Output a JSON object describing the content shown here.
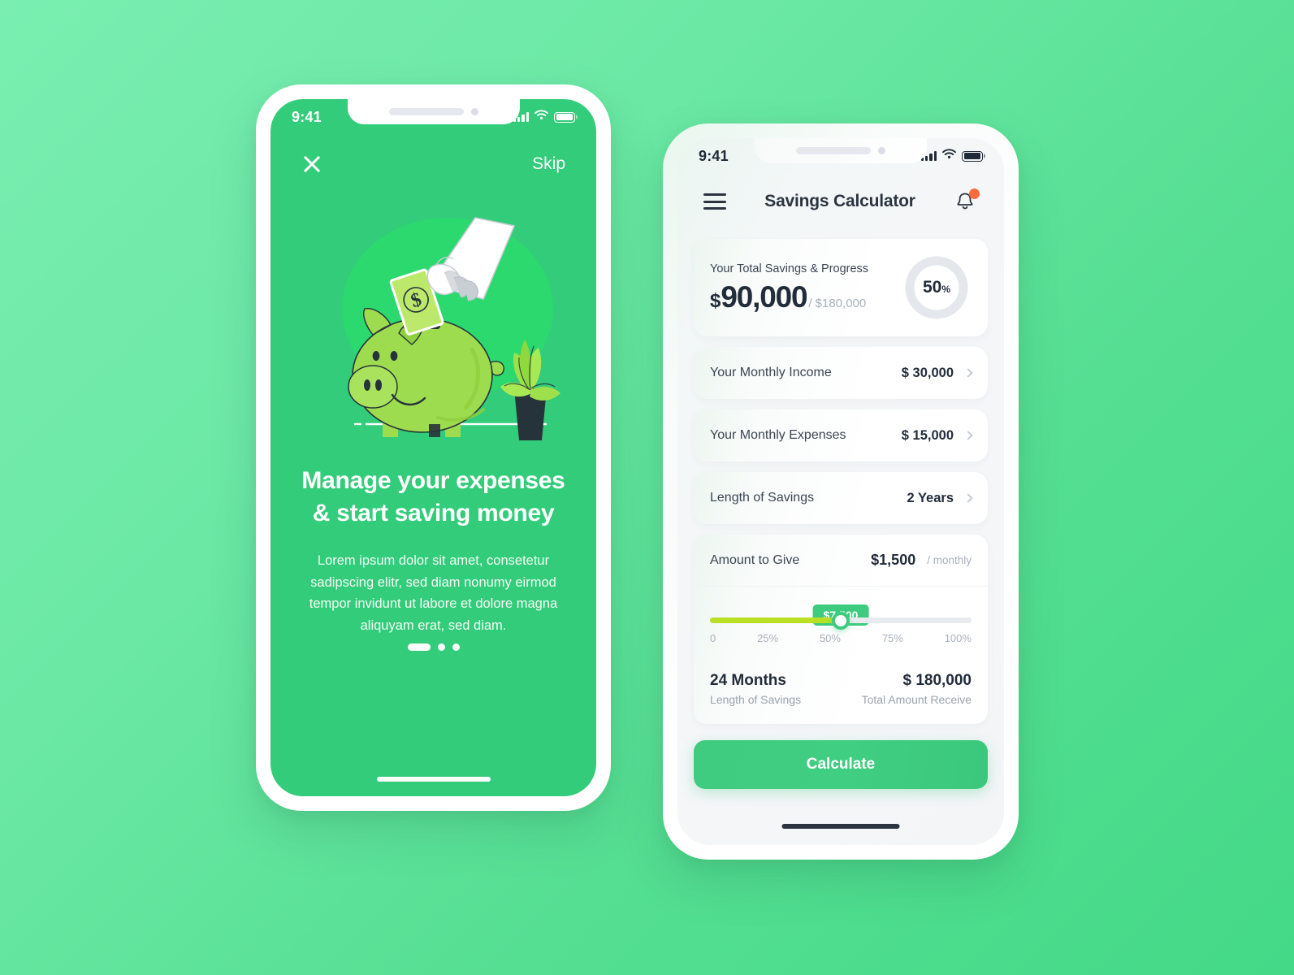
{
  "onboarding": {
    "status_bar": {
      "time": "9:41",
      "signal_icon": "signal-bars-icon",
      "wifi_icon": "wifi-icon",
      "battery_icon": "battery-icon"
    },
    "close_label": "✕",
    "skip_label": "Skip",
    "illustration_name": "hand-putting-money-in-piggy-bank-illustration",
    "title_line1": "Manage your expenses",
    "title_line2": "& start saving money",
    "description": "Lorem ipsum dolor sit amet, consetetur sadipscing elitr, sed diam nonumy eirmod tempor invidunt ut labore et dolore magna aliquyam erat, sed diam.",
    "pager": {
      "total": 3,
      "active_index": 0
    }
  },
  "calculator": {
    "status_bar": {
      "time": "9:41",
      "signal_icon": "signal-bars-icon",
      "wifi_icon": "wifi-icon",
      "battery_icon": "battery-icon"
    },
    "app_bar": {
      "menu_icon": "hamburger-menu-icon",
      "title": "Savings Calculator",
      "notifications_icon": "bell-icon",
      "badge_color": "#FF6B3D"
    },
    "savings_card": {
      "label": "Your Total Savings & Progress",
      "currency": "$",
      "amount": "90,000",
      "of_total": "/ $180,000",
      "progress_percent": "50",
      "percent_symbol": "%",
      "progress_value": 50,
      "ring_fill_color": "#3CCB7F",
      "ring_track_color": "#E4E7EC"
    },
    "rows": [
      {
        "label": "Your Monthly Income",
        "value": "$ 30,000",
        "chevron_icon": "chevron-right-icon"
      },
      {
        "label": "Your Monthly Expenses",
        "value": "$ 15,000",
        "chevron_icon": "chevron-right-icon"
      },
      {
        "label": "Length of Savings",
        "value": "2 Years",
        "chevron_icon": "chevron-right-icon"
      }
    ],
    "amount_to_give": {
      "label": "Amount to Give",
      "value": "$1,500",
      "period": "/ monthly"
    },
    "slider": {
      "tooltip_value": "$7,500",
      "position_percent": 50,
      "fill_color": "#B9E024",
      "thumb_color": "#3CCB7F",
      "ticks": [
        "0",
        "25%",
        "50%",
        "75%",
        "100%"
      ]
    },
    "summary": {
      "left_value": "24 Months",
      "left_label": "Length of Savings",
      "right_value": "$ 180,000",
      "right_label": "Total Amount Receive"
    },
    "calculate_label": "Calculate"
  }
}
